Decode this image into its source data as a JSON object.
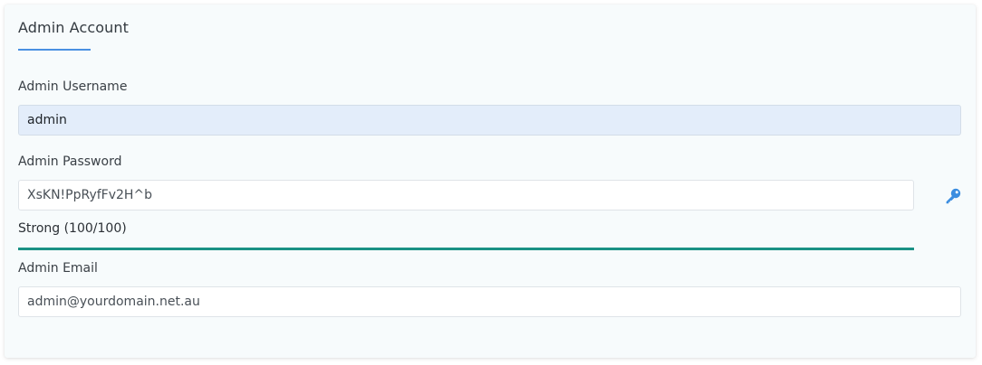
{
  "section": {
    "title": "Admin Account"
  },
  "username": {
    "label": "Admin Username",
    "value": "admin"
  },
  "password": {
    "label": "Admin Password",
    "value": "XsKN!PpRyfFv2H^b",
    "generate_icon": "key-icon",
    "strength_label": "Strong (100/100)",
    "strength_fraction": 1.0
  },
  "email": {
    "label": "Admin Email",
    "value": "admin@yourdomain.net.au"
  },
  "colors": {
    "accent": "#4a90e2",
    "strength_bar": "#1a9185",
    "username_bg": "#e3edfa",
    "key_icon": "#3b8de0"
  }
}
